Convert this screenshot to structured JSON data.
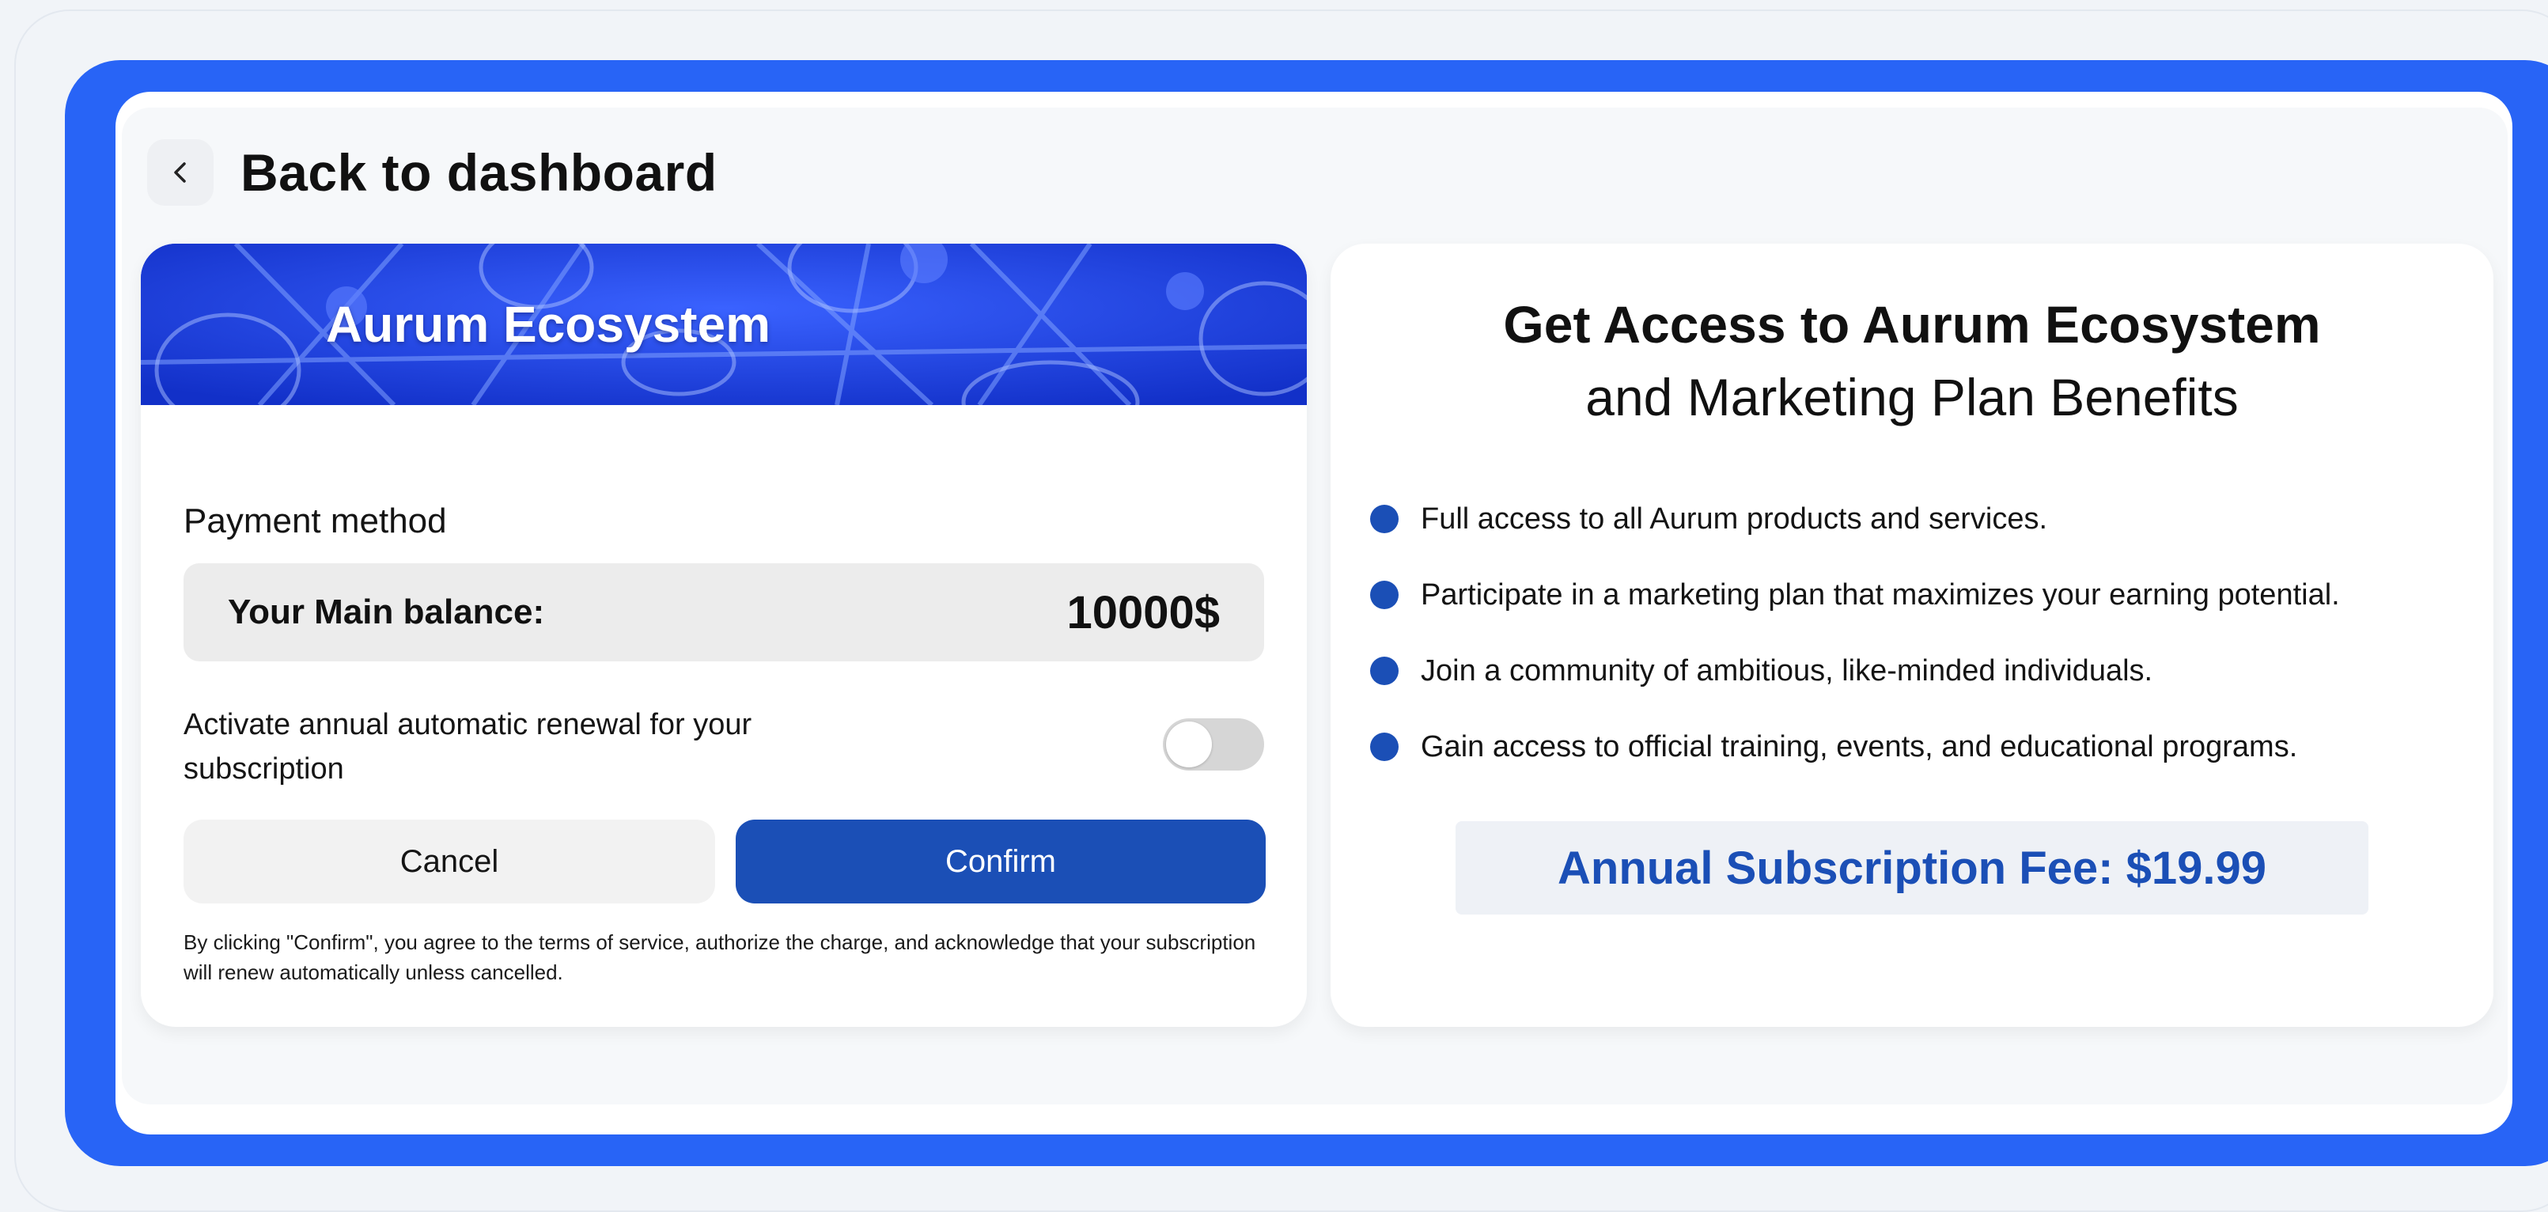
{
  "header": {
    "back_label": "Back to dashboard",
    "back_icon": "chevron-left-icon"
  },
  "product_card": {
    "banner_title": "Aurum Ecosystem",
    "payment_method_label": "Payment method",
    "balance_label": "Your Main balance:",
    "balance_value": "10000$",
    "auto_renew_label": "Activate annual automatic renewal for your subscription",
    "auto_renew_enabled": false,
    "cancel_label": "Cancel",
    "confirm_label": "Confirm",
    "terms_text": "By clicking \"Confirm\", you agree to the terms of service, authorize the charge, and acknowledge that your subscription will renew automatically unless cancelled."
  },
  "benefits_card": {
    "title_line1": "Get Access to Aurum Ecosystem",
    "title_line2": "and Marketing Plan Benefits",
    "items": [
      "Full access to all Aurum products and services.",
      "Participate in a marketing plan that maximizes your earning potential.",
      "Join a community of ambitious, like-minded individuals.",
      "Gain access to official training, events, and educational programs."
    ],
    "fee_text": "Annual Subscription Fee: $19.99"
  },
  "colors": {
    "frame_blue": "#2864f6",
    "primary_blue": "#1b4fb6",
    "banner_blue": "#1d3fe6"
  }
}
